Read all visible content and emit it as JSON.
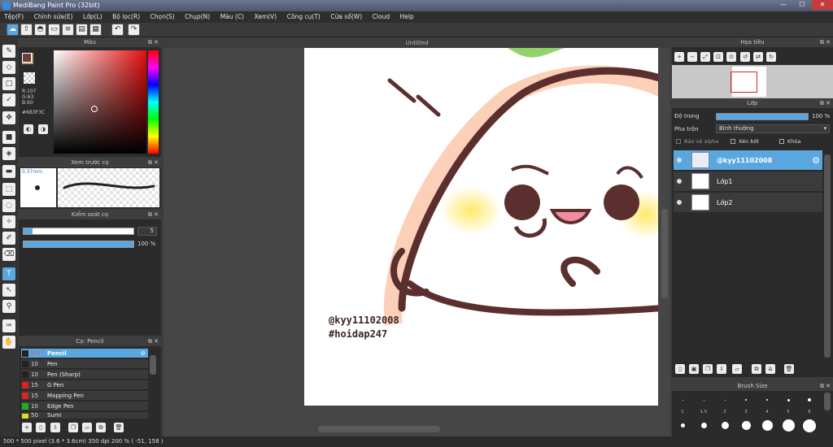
{
  "title": "MediBang Paint Pro (32bit)",
  "window_controls": {
    "min": "—",
    "max": "☐",
    "close": "✕"
  },
  "menu": [
    "Tệp(F)",
    "Chỉnh sửa(E)",
    "Lớp(L)",
    "Bộ lọc(R)",
    "Chọn(S)",
    "Chụp(N)",
    "Màu (C)",
    "Xem(V)",
    "Công cụ(T)",
    "Cửa sổ(W)",
    "Cloud",
    "Help"
  ],
  "color_panel": {
    "title": "Màu",
    "r": "R:107",
    "g": "G:63",
    "b": "B:60",
    "hex": "#6B3F3C",
    "fg": "#6b3f3c",
    "bg": "#f0a050"
  },
  "brush_preview": {
    "title": "Xem trước cọ",
    "size": "0.37mm"
  },
  "brush_control": {
    "title": "Kiểm soát cọ",
    "size_value": "5",
    "opacity_value": "100 %"
  },
  "brush_list": {
    "title": "Cọ: Pencil",
    "items": [
      {
        "size": "5.0",
        "name": "Pencil",
        "color": "#222222"
      },
      {
        "size": "10",
        "name": "Pen",
        "color": "#222222"
      },
      {
        "size": "10",
        "name": "Pen (Sharp)",
        "color": "#222222"
      },
      {
        "size": "15",
        "name": "G Pen",
        "color": "#dd2222"
      },
      {
        "size": "15",
        "name": "Mapping Pen",
        "color": "#dd2222"
      },
      {
        "size": "10",
        "name": "Edge Pen",
        "color": "#22aa22"
      },
      {
        "size": "50",
        "name": "Sumi",
        "color": "#dddd22"
      }
    ]
  },
  "canvas": {
    "doc_title": "Untitled",
    "watermark_line1": "@kyy11102008",
    "watermark_line2": "#hoidap247"
  },
  "navigator": {
    "title": "Họa tiêu"
  },
  "layers": {
    "title": "Lớp",
    "opacity_label": "Độ trong",
    "opacity_value": "100 %",
    "blend_label": "Pha trộn",
    "blend_value": "Bình thường",
    "protect_alpha": "Bảo vệ alpha",
    "clipping": "Xén bớt",
    "lock": "Khóa",
    "items": [
      {
        "name": "@kyy11102008"
      },
      {
        "name": "Lớp1"
      },
      {
        "name": "Lớp2"
      }
    ]
  },
  "brush_size": {
    "title": "Brush Size",
    "row1_labels": [
      "1",
      "1.5",
      "2",
      "3",
      "4",
      "5",
      "6",
      "8"
    ],
    "row2_labels": [
      "1",
      "15",
      "3",
      "3",
      "4",
      "5",
      "5",
      "6"
    ]
  },
  "status": "500 * 500 pixel   (3.6 * 3.6cm)   350 dpi   200 %   ( -51, 158 )"
}
